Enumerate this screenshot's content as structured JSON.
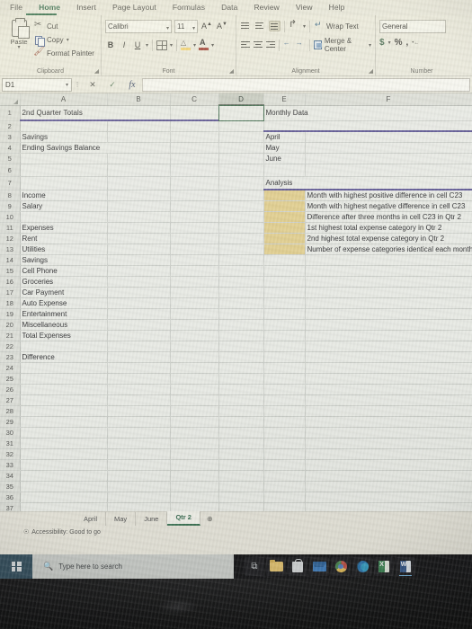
{
  "app": {
    "ribbon_tabs": [
      {
        "label": "File",
        "active": false
      },
      {
        "label": "Home",
        "active": true
      },
      {
        "label": "Insert",
        "active": false
      },
      {
        "label": "Page Layout",
        "active": false
      },
      {
        "label": "Formulas",
        "active": false
      },
      {
        "label": "Data",
        "active": false
      },
      {
        "label": "Review",
        "active": false
      },
      {
        "label": "View",
        "active": false
      },
      {
        "label": "Help",
        "active": false
      }
    ],
    "accent_color": "#217346"
  },
  "ribbon": {
    "clipboard": {
      "group_label": "Clipboard",
      "paste_label": "Paste",
      "cut_label": "Cut",
      "copy_label": "Copy",
      "format_painter_label": "Format Painter"
    },
    "font": {
      "group_label": "Font",
      "font_name": "Calibri",
      "font_size": "11",
      "bold_label": "B",
      "italic_label": "I",
      "underline_label": "U",
      "grow_font_label": "A",
      "shrink_font_label": "A"
    },
    "alignment": {
      "group_label": "Alignment",
      "wrap_text_label": "Wrap Text",
      "merge_center_label": "Merge & Center"
    },
    "number": {
      "group_label": "Number",
      "format": "General",
      "currency_label": "$",
      "percent_label": "%",
      "comma_label": ","
    }
  },
  "formula_bar": {
    "name_box": "D1",
    "cancel_label": "✕",
    "enter_label": "✓",
    "fx_label": "fx",
    "value": ""
  },
  "grid": {
    "columns": [
      "A",
      "B",
      "C",
      "D",
      "E",
      "F"
    ],
    "selected_column": "D",
    "selected_cell": "D1",
    "rows": [
      {
        "n": "1",
        "a": "2nd Quarter Totals",
        "e": "Monthly Data"
      },
      {
        "n": "2",
        "a": "",
        "e": ""
      },
      {
        "n": "3",
        "a": "Savings",
        "e": "April"
      },
      {
        "n": "4",
        "a": "Ending Savings Balance",
        "e": "May"
      },
      {
        "n": "5",
        "a": "",
        "e": "June"
      },
      {
        "n": "6",
        "a": "",
        "e": ""
      },
      {
        "n": "7",
        "a": "",
        "e": "Analysis"
      },
      {
        "n": "8",
        "a": "Income",
        "e": "",
        "f": "Month with highest positive difference in cell C23"
      },
      {
        "n": "9",
        "a": "Salary",
        "e": "",
        "f": "Month with highest negative difference in cell C23"
      },
      {
        "n": "10",
        "a": "",
        "e": "",
        "f": "Difference after three months in cell C23 in Qtr 2"
      },
      {
        "n": "11",
        "a": "Expenses",
        "e": "",
        "f": "1st highest total expense category in Qtr 2"
      },
      {
        "n": "12",
        "a": "Rent",
        "e": "",
        "f": "2nd highest total expense category in Qtr 2"
      },
      {
        "n": "13",
        "a": "Utilities",
        "e": "",
        "f": "Number of expense categories identical each month"
      },
      {
        "n": "14",
        "a": "Savings",
        "e": ""
      },
      {
        "n": "15",
        "a": "Cell Phone",
        "e": ""
      },
      {
        "n": "16",
        "a": "Groceries",
        "e": ""
      },
      {
        "n": "17",
        "a": "Car Payment",
        "e": ""
      },
      {
        "n": "18",
        "a": "Auto Expense",
        "e": ""
      },
      {
        "n": "19",
        "a": "Entertainment",
        "e": ""
      },
      {
        "n": "20",
        "a": "Miscellaneous",
        "e": ""
      },
      {
        "n": "21",
        "a": "Total Expenses",
        "e": ""
      },
      {
        "n": "22",
        "a": "",
        "e": ""
      },
      {
        "n": "23",
        "a": "Difference",
        "e": ""
      },
      {
        "n": "24",
        "a": "",
        "e": ""
      },
      {
        "n": "25",
        "a": "",
        "e": ""
      },
      {
        "n": "26",
        "a": "",
        "e": ""
      },
      {
        "n": "27",
        "a": "",
        "e": ""
      },
      {
        "n": "28",
        "a": "",
        "e": ""
      },
      {
        "n": "29",
        "a": "",
        "e": ""
      },
      {
        "n": "30",
        "a": "",
        "e": ""
      },
      {
        "n": "31",
        "a": "",
        "e": ""
      },
      {
        "n": "32",
        "a": "",
        "e": ""
      },
      {
        "n": "33",
        "a": "",
        "e": ""
      },
      {
        "n": "34",
        "a": "",
        "e": ""
      },
      {
        "n": "35",
        "a": "",
        "e": ""
      },
      {
        "n": "36",
        "a": "",
        "e": ""
      },
      {
        "n": "37",
        "a": "",
        "e": ""
      }
    ],
    "answer_fill_color": "#e9cd72",
    "title_underline_color": "#5b51a8"
  },
  "sheet_tabs": {
    "tabs": [
      {
        "label": "April",
        "active": false
      },
      {
        "label": "May",
        "active": false
      },
      {
        "label": "June",
        "active": false
      },
      {
        "label": "Qtr 2",
        "active": true
      }
    ],
    "add_label": "⊕"
  },
  "status_bar": {
    "accessibility": "Accessibility: Good to go"
  },
  "taskbar": {
    "search_placeholder": "Type here to search",
    "icons": [
      {
        "name": "task-view-icon",
        "label": "⧉"
      },
      {
        "name": "file-explorer-icon",
        "label": ""
      },
      {
        "name": "microsoft-store-icon",
        "label": ""
      },
      {
        "name": "mail-icon",
        "label": ""
      },
      {
        "name": "chrome-icon",
        "label": ""
      },
      {
        "name": "edge-icon",
        "label": ""
      },
      {
        "name": "excel-icon",
        "label": ""
      },
      {
        "name": "word-icon",
        "label": ""
      }
    ]
  }
}
